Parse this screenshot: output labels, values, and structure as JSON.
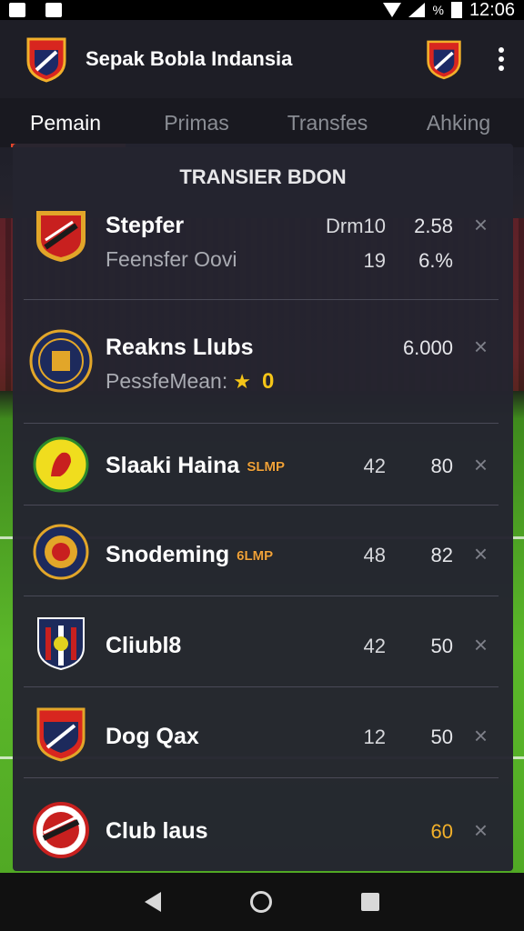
{
  "status_bar": {
    "battery_text": "%",
    "time": "12:06"
  },
  "app": {
    "title": "Sepak Bobla Indansia",
    "menu_icon": "more-vert-icon"
  },
  "tabs": [
    {
      "label": "Pemain",
      "active": true
    },
    {
      "label": "Primas",
      "active": false
    },
    {
      "label": "Transfes",
      "active": false
    },
    {
      "label": "Ahking",
      "active": false
    }
  ],
  "panel": {
    "title": "TRANSIER BDON"
  },
  "rows": [
    {
      "name": "Stepfer",
      "sub": "Feensfer Oovi",
      "v1": "Drm10",
      "v2": "2.58",
      "v1b": "19",
      "v2b": "6.%"
    },
    {
      "name": "Reakns Llubs",
      "sub": "PessfeMean:",
      "v2": "6.000",
      "star": "★",
      "score": "0"
    },
    {
      "name": "Slaaki Haina",
      "badge": "SLMP",
      "v1": "42",
      "v2": "80"
    },
    {
      "name": "Snodeming",
      "badge": "6LMP",
      "v1": "48",
      "v2": "82"
    },
    {
      "name": "Cliubl8",
      "v1": "42",
      "v2": "50"
    },
    {
      "name": "Dog Qax",
      "v1": "12",
      "v2": "50"
    },
    {
      "name": "Club laus",
      "v2": "60"
    }
  ],
  "close_glyph": "×",
  "colors": {
    "accent": "#e2452b",
    "gold": "#f2b02a",
    "panel": "#242430"
  }
}
